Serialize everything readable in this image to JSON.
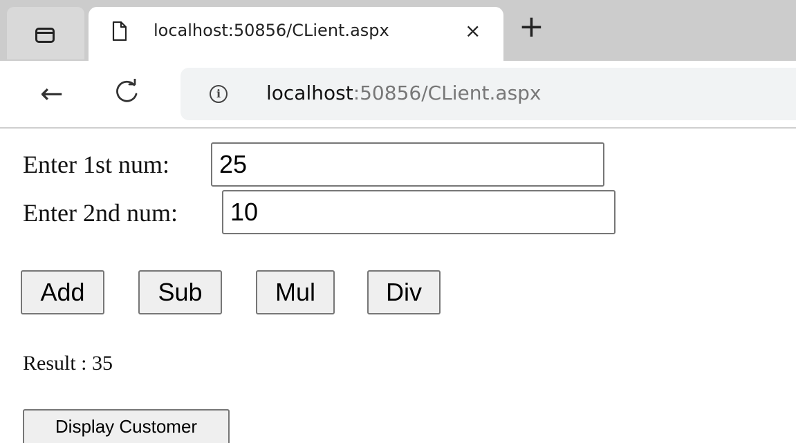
{
  "browser": {
    "tab_title": "localhost:50856/CLient.aspx",
    "tab_close": "×",
    "new_tab": "+",
    "url_host": "localhost",
    "url_rest": ":50856/CLient.aspx",
    "icons": {
      "tab_actions": "tab-actions-icon",
      "page": "page-icon",
      "back": "back-arrow-icon",
      "reload": "reload-icon",
      "info": "info-icon"
    }
  },
  "form": {
    "num1_label": "Enter 1st num:",
    "num1_value": "25",
    "num2_label": "Enter 2nd num:",
    "num2_value": "10",
    "buttons": {
      "add": "Add",
      "sub": "Sub",
      "mul": "Mul",
      "div": "Div"
    },
    "result_text": "Result : 35",
    "display_customer": "Display Customer"
  }
}
